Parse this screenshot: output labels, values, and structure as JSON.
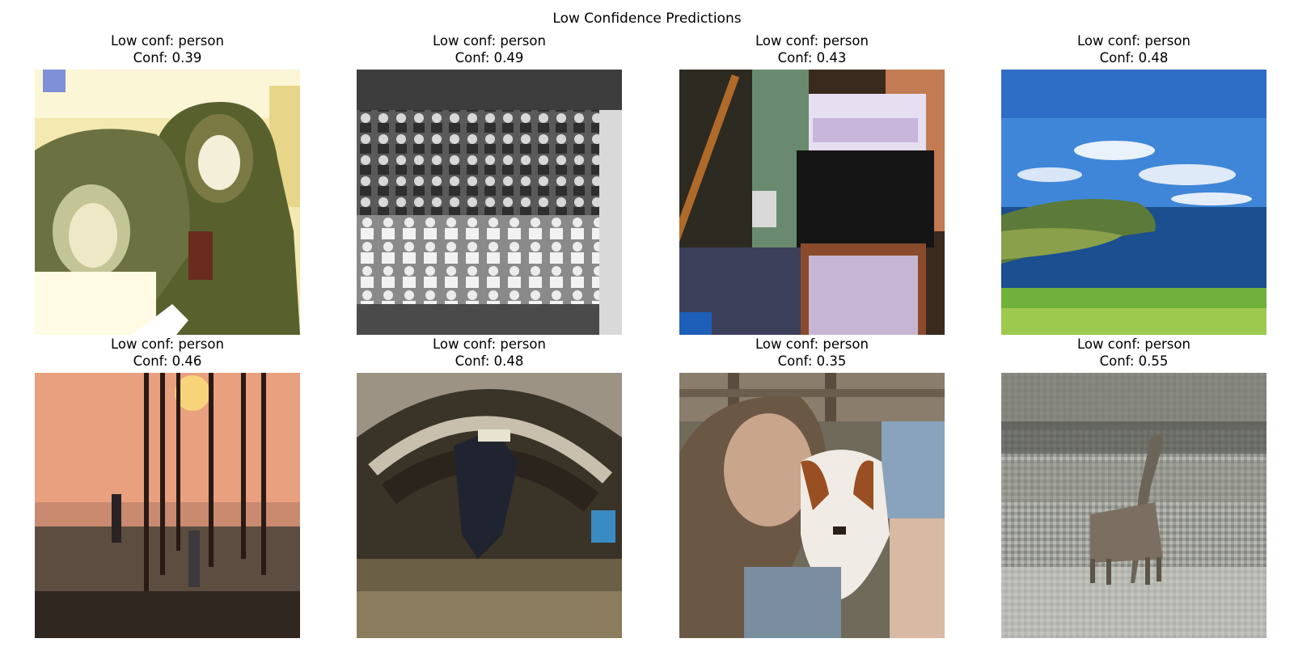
{
  "figure": {
    "title": "Low Confidence Predictions"
  },
  "panels": [
    {
      "title": "Low conf: person",
      "conf": "Conf: 0.39",
      "scene": "two-people-hooded-jackets"
    },
    {
      "title": "Low conf: person",
      "conf": "Conf: 0.49",
      "scene": "black-and-white-group-photo"
    },
    {
      "title": "Low conf: person",
      "conf": "Conf: 0.43",
      "scene": "desk-with-monitor"
    },
    {
      "title": "Low conf: person",
      "conf": "Conf: 0.48",
      "scene": "coastline-island-sea"
    },
    {
      "title": "Low conf: person",
      "conf": "Conf: 0.46",
      "scene": "sunset-pier-with-people"
    },
    {
      "title": "Low conf: person",
      "conf": "Conf: 0.48",
      "scene": "skateboarder-in-arch"
    },
    {
      "title": "Low conf: person",
      "conf": "Conf: 0.35",
      "scene": "person-with-puppy"
    },
    {
      "title": "Low conf: person",
      "conf": "Conf: 0.55",
      "scene": "giraffe-in-savanna"
    }
  ]
}
